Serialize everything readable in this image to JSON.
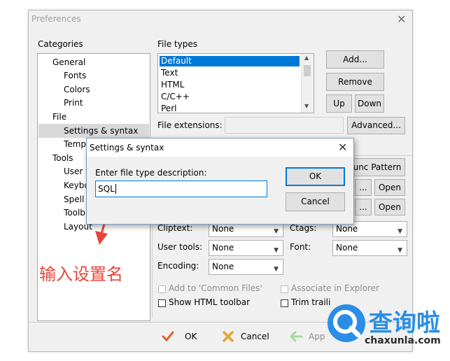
{
  "window": {
    "title": "Preferences",
    "close_glyph": "✕"
  },
  "categories": {
    "label": "Categories",
    "items": [
      {
        "text": "General"
      },
      {
        "text": "Fonts"
      },
      {
        "text": "Colors"
      },
      {
        "text": "Print"
      },
      {
        "text": "File"
      },
      {
        "text": "Settings & syntax"
      },
      {
        "text": "Temp"
      },
      {
        "text": "Tools"
      },
      {
        "text": "User t"
      },
      {
        "text": "Keybo"
      },
      {
        "text": "Spell"
      },
      {
        "text": "Toolb"
      },
      {
        "text": "Layout"
      }
    ]
  },
  "file_types": {
    "label": "File types",
    "items": [
      "Default",
      "Text",
      "HTML",
      "C/C++",
      "Perl"
    ],
    "selected": "Default"
  },
  "buttons": {
    "add": "Add...",
    "remove": "Remove",
    "up": "Up",
    "down": "Down",
    "advanced": "Advanced...",
    "func_pattern": "unc Pattern",
    "browse1": "...",
    "open1": "Open",
    "browse2": "...",
    "open2": "Open"
  },
  "file_extensions": {
    "label": "File extensions:",
    "value": ""
  },
  "options": {
    "cliptext": {
      "label": "Cliptext:",
      "value": "None"
    },
    "user_tools": {
      "label": "User tools:",
      "value": "None"
    },
    "encoding": {
      "label": "Encoding:",
      "value": "None"
    },
    "ctags": {
      "label": "Ctags:",
      "value": "None"
    },
    "font": {
      "label": "Font:",
      "value": "None"
    }
  },
  "checkboxes": {
    "add_common": "Add to 'Common Files'",
    "show_html_toolbar": "Show HTML toolbar",
    "associate_explorer": "Associate in Explorer",
    "trim_trailing": "Trim traili"
  },
  "footer": {
    "ok": "OK",
    "cancel": "Cancel",
    "apply": "App"
  },
  "dialog": {
    "title": "Settings & syntax",
    "prompt": "Enter file type description:",
    "value": "SQL",
    "ok": "OK",
    "cancel": "Cancel"
  },
  "annotation": {
    "text": "输入设置名",
    "color": "#e8443a"
  },
  "watermark": {
    "brand_cn": "查询啦",
    "brand_url": "chaxunla.com",
    "color": "#2a8ee8"
  }
}
